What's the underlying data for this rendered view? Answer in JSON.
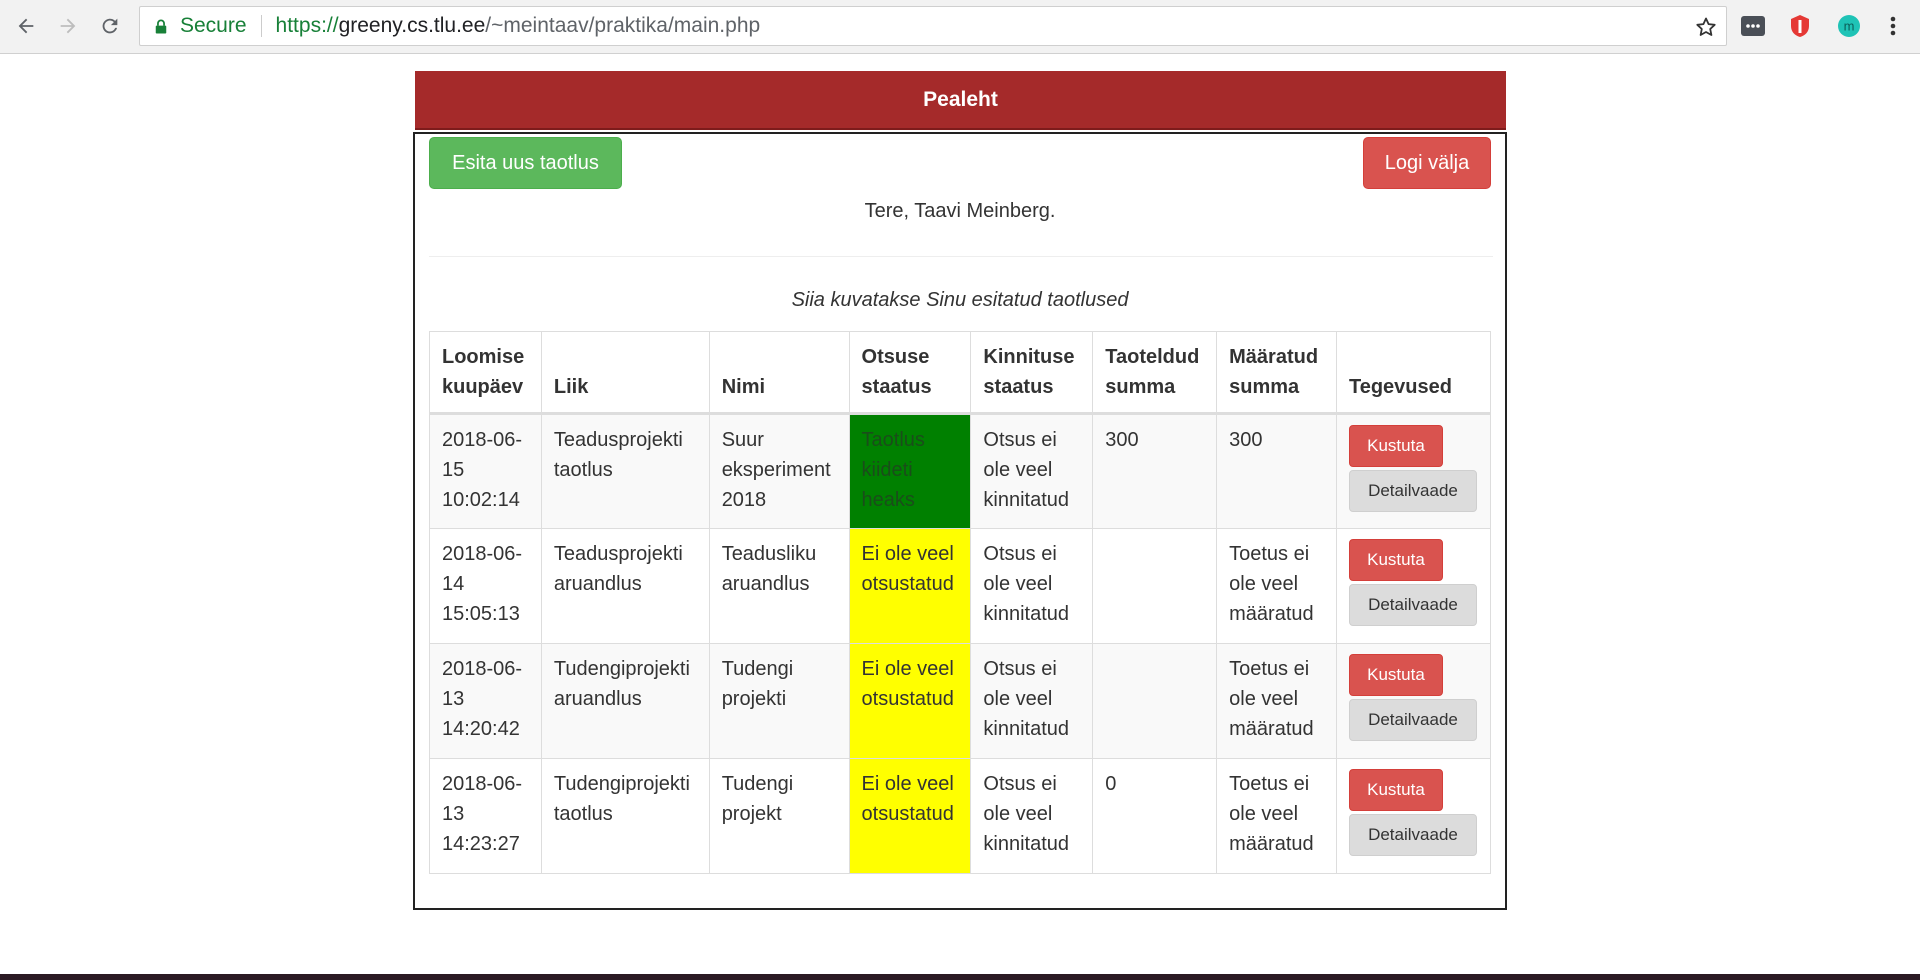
{
  "browser": {
    "secure_label": "Secure",
    "url_scheme": "https://",
    "url_host": "greeny.cs.tlu.ee",
    "url_path": "/~meintaav/praktika/main.php",
    "extension_letter": "m"
  },
  "header": {
    "title": "Pealeht"
  },
  "actions": {
    "new_label": "Esita uus taotlus",
    "logout_label": "Logi välja"
  },
  "greeting": "Tere, Taavi Meinberg.",
  "caption": "Siia kuvatakse Sinu esitatud taotlused",
  "table": {
    "columns": [
      "Loomise kuupäev",
      "Liik",
      "Nimi",
      "Otsuse staatus",
      "Kinnituse staatus",
      "Taoteldud summa",
      "Määratud summa",
      "Tegevused"
    ],
    "delete_label": "Kustuta",
    "detail_label": "Detailvaade",
    "rows": [
      {
        "date": "2018-06-15 10:02:14",
        "type": "Teadusprojekti taotlus",
        "name": "Suur eksperiment 2018",
        "decision": "Taotlus kiideti heaks",
        "decision_color": "#008000",
        "confirmation": "Otsus ei ole veel kinnitatud",
        "requested": "300",
        "assigned": "300"
      },
      {
        "date": "2018-06-14 15:05:13",
        "type": "Teadusprojekti aruandlus",
        "name": "Teadusliku aruandlus",
        "decision": "Ei ole veel otsustatud",
        "decision_color": "#ffff00",
        "confirmation": "Otsus ei ole veel kinnitatud",
        "requested": "",
        "assigned": "Toetus ei ole veel määratud"
      },
      {
        "date": "2018-06-13 14:20:42",
        "type": "Tudengiprojekti aruandlus",
        "name": "Tudengi projekti",
        "decision": "Ei ole veel otsustatud",
        "decision_color": "#ffff00",
        "confirmation": "Otsus ei ole veel kinnitatud",
        "requested": "",
        "assigned": "Toetus ei ole veel määratud"
      },
      {
        "date": "2018-06-13 14:23:27",
        "type": "Tudengiprojekti taotlus",
        "name": "Tudengi projekt",
        "decision": "Ei ole veel otsustatud",
        "decision_color": "#ffff00",
        "confirmation": "Otsus ei ole veel kinnitatud",
        "requested": "0",
        "assigned": "Toetus ei ole veel määratud"
      }
    ]
  }
}
